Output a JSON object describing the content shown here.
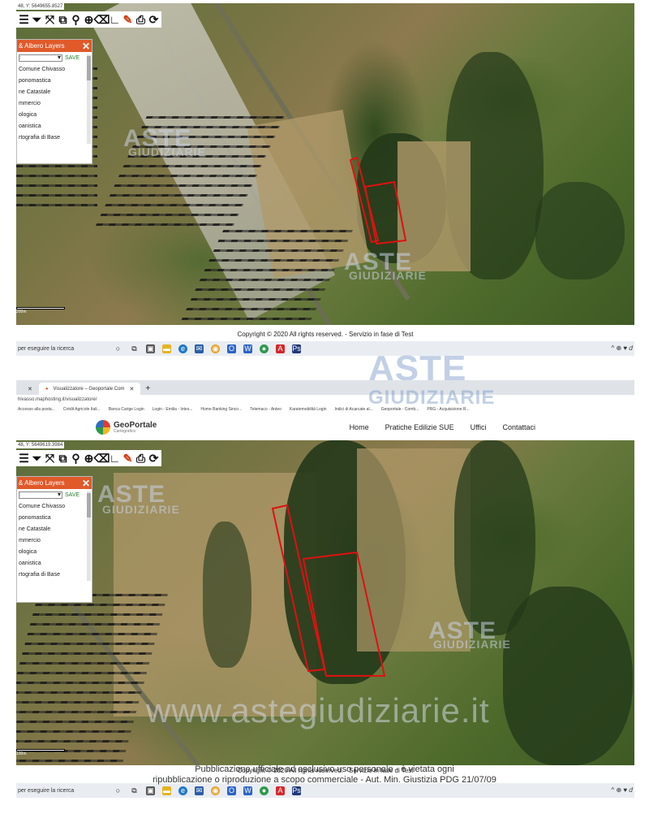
{
  "watermark_text": "ASTE",
  "watermark_sub": "GIUDIZIARIE",
  "site_watermark": "www.astegiudiziarie.it",
  "legal_notice_line1": "Pubblicazione ufficiale ad esclusivo uso personale - è vietata ogni",
  "legal_notice_line2": "ripubblicazione o riproduzione a scopo commerciale - Aut. Min. Giustizia PDG 21/07/09",
  "shot1": {
    "coords": "48, Y: 5649655.8527",
    "layers_title": "& Albero Layers",
    "layers_close": "✕",
    "select_value": ":",
    "save_label": "SAVE",
    "layer_items": [
      "Comune Chivasso",
      "ponomastica",
      "ne Catastale",
      "mmercio",
      "ologica",
      "oanistica",
      "rtografia di Base"
    ],
    "scale_label": "200m",
    "footer": "Copyright © 2020 All rights reserved. - Servizio in fase di Test",
    "taskbar_search": "per eseguire la ricerca",
    "tray": "^ ⊕ ♥ 𝑑"
  },
  "shot2": {
    "tabs": [
      {
        "label": "",
        "close": "✕"
      },
      {
        "label": "Visualizzatore – Geoportale Com",
        "close": "✕"
      }
    ],
    "new_tab": "+",
    "address": "hivasso.maphosting.it/visualizzatore/",
    "bookmarks": [
      "Accesso alla posta...",
      "Crédit Agricole Itali...",
      "Banca Carige Login",
      "Login - Emilia - Intes...",
      "Home Banking Sinco...",
      "Telemaco - Anteo",
      "Karatemobilità Login",
      "Indici di Acarcate al...",
      "Geoportale - Comb...",
      "PRG - Acquisizione R..."
    ],
    "logo_title": "GeoPortale",
    "logo_sub": "Cartografico",
    "nav": [
      "Home",
      "Pratiche Edilizie SUE",
      "Uffici",
      "Contattaci"
    ],
    "coords": "48, Y: 5649619.3984",
    "layers_title": "& Albero Layers",
    "layers_close": "✕",
    "select_value": ":",
    "save_label": "SAVE",
    "layer_items": [
      "Comune Chivasso",
      "ponomastica",
      "ne Catastale",
      "mmercio",
      "ologica",
      "oanistica",
      "rtografia di Base"
    ],
    "scale_label": "100m",
    "footer": "Copyright © 2020 All rights reserved. - Servizio in fase di Test",
    "taskbar_search": "per eseguire la ricerca",
    "tray": "^ ⊕ ♥ 𝑑"
  },
  "toolbar_icons": [
    "list-icon",
    "filter-icon",
    "zoom-extent-icon",
    "zoom-window-icon",
    "pin-icon",
    "crosshair-icon",
    "eraser-icon",
    "measure-icon",
    "draw-icon",
    "print-icon",
    "refresh-icon"
  ],
  "colors": {
    "parcel": "#e01010",
    "layers_header": "#e05a2a",
    "save": "#2a7d2a"
  }
}
